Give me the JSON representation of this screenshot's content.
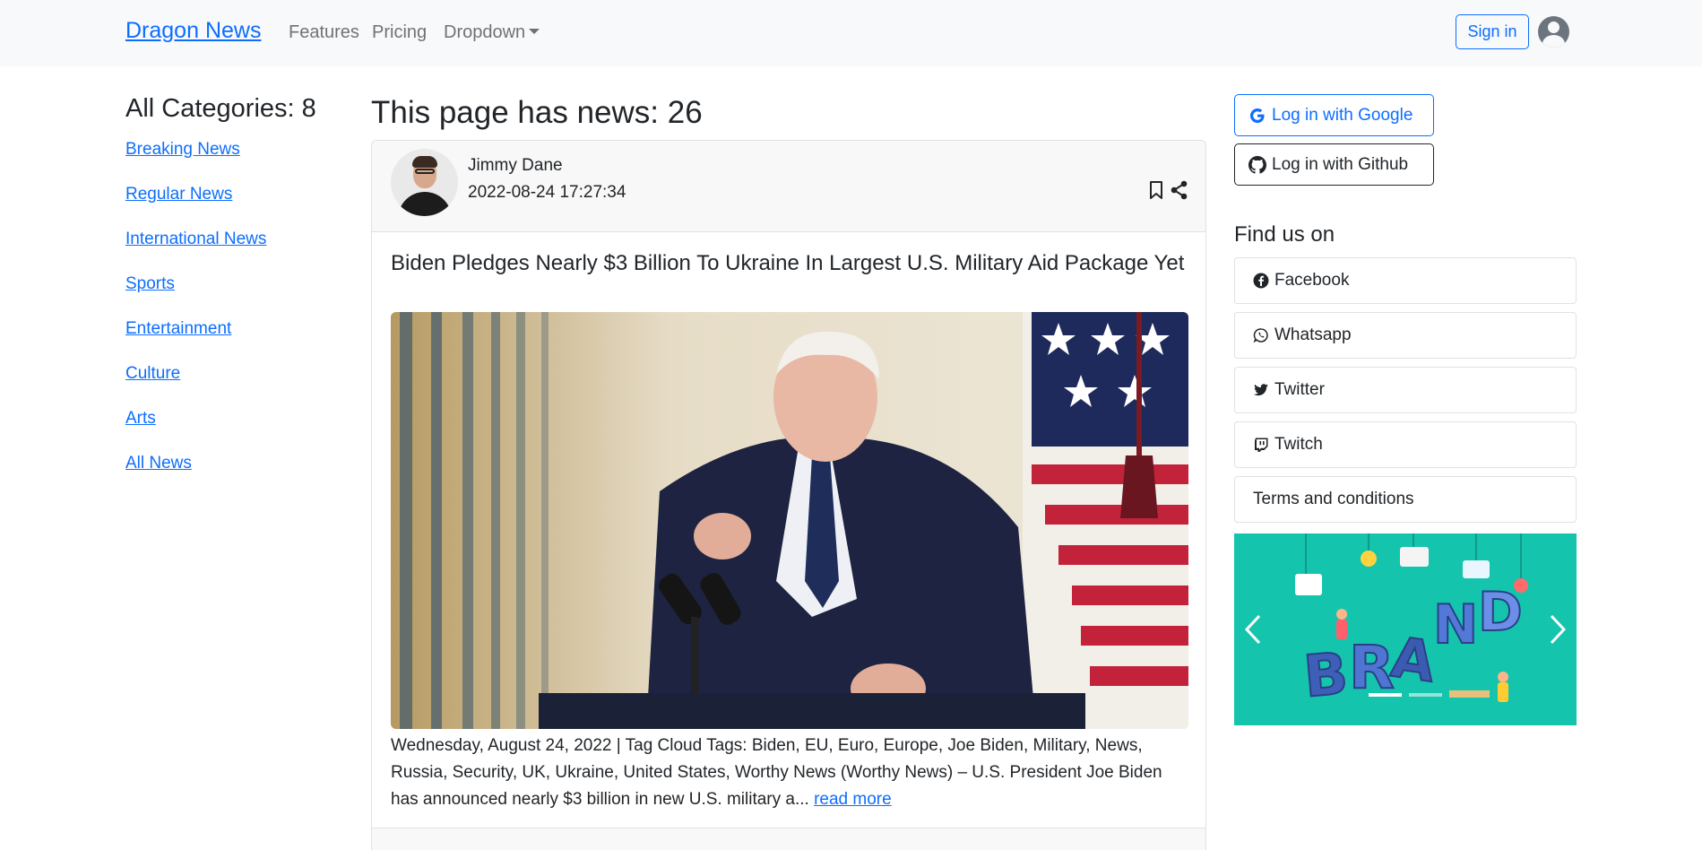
{
  "navbar": {
    "brand": "Dragon News",
    "links": [
      "Features",
      "Pricing",
      "Dropdown"
    ],
    "signin_label": "Sign in"
  },
  "categories": {
    "heading": "All Categories: 8",
    "items": [
      "Breaking News",
      "Regular News",
      "International News",
      "Sports",
      "Entertainment",
      "Culture",
      "Arts",
      "All News"
    ]
  },
  "main": {
    "heading": "This page has news: 26",
    "article": {
      "author": "Jimmy Dane",
      "date": "2022-08-24 17:27:34",
      "title": "Biden Pledges Nearly $3 Billion To Ukraine In Largest U.S. Military Aid Package Yet",
      "details": "Wednesday, August 24, 2022 | Tag Cloud Tags: Biden, EU, Euro, Europe, Joe Biden, Military, News, Russia, Security, UK, Ukraine, United States, Worthy News (Worthy News) – U.S. President Joe Biden has announced nearly $3 billion in new U.S. military a...",
      "read_more": "read more"
    }
  },
  "right": {
    "google_label": "Log in with Google",
    "github_label": "Log in with Github",
    "find_heading": "Find us on",
    "social": [
      "Facebook",
      "Whatsapp",
      "Twitter",
      "Twitch",
      "Terms and conditions"
    ],
    "banner_word": "BRAND"
  },
  "colors": {
    "primary": "#0d6efd",
    "navbar_bg": "#f8f9fa",
    "banner_bg": "#15c4ad"
  }
}
